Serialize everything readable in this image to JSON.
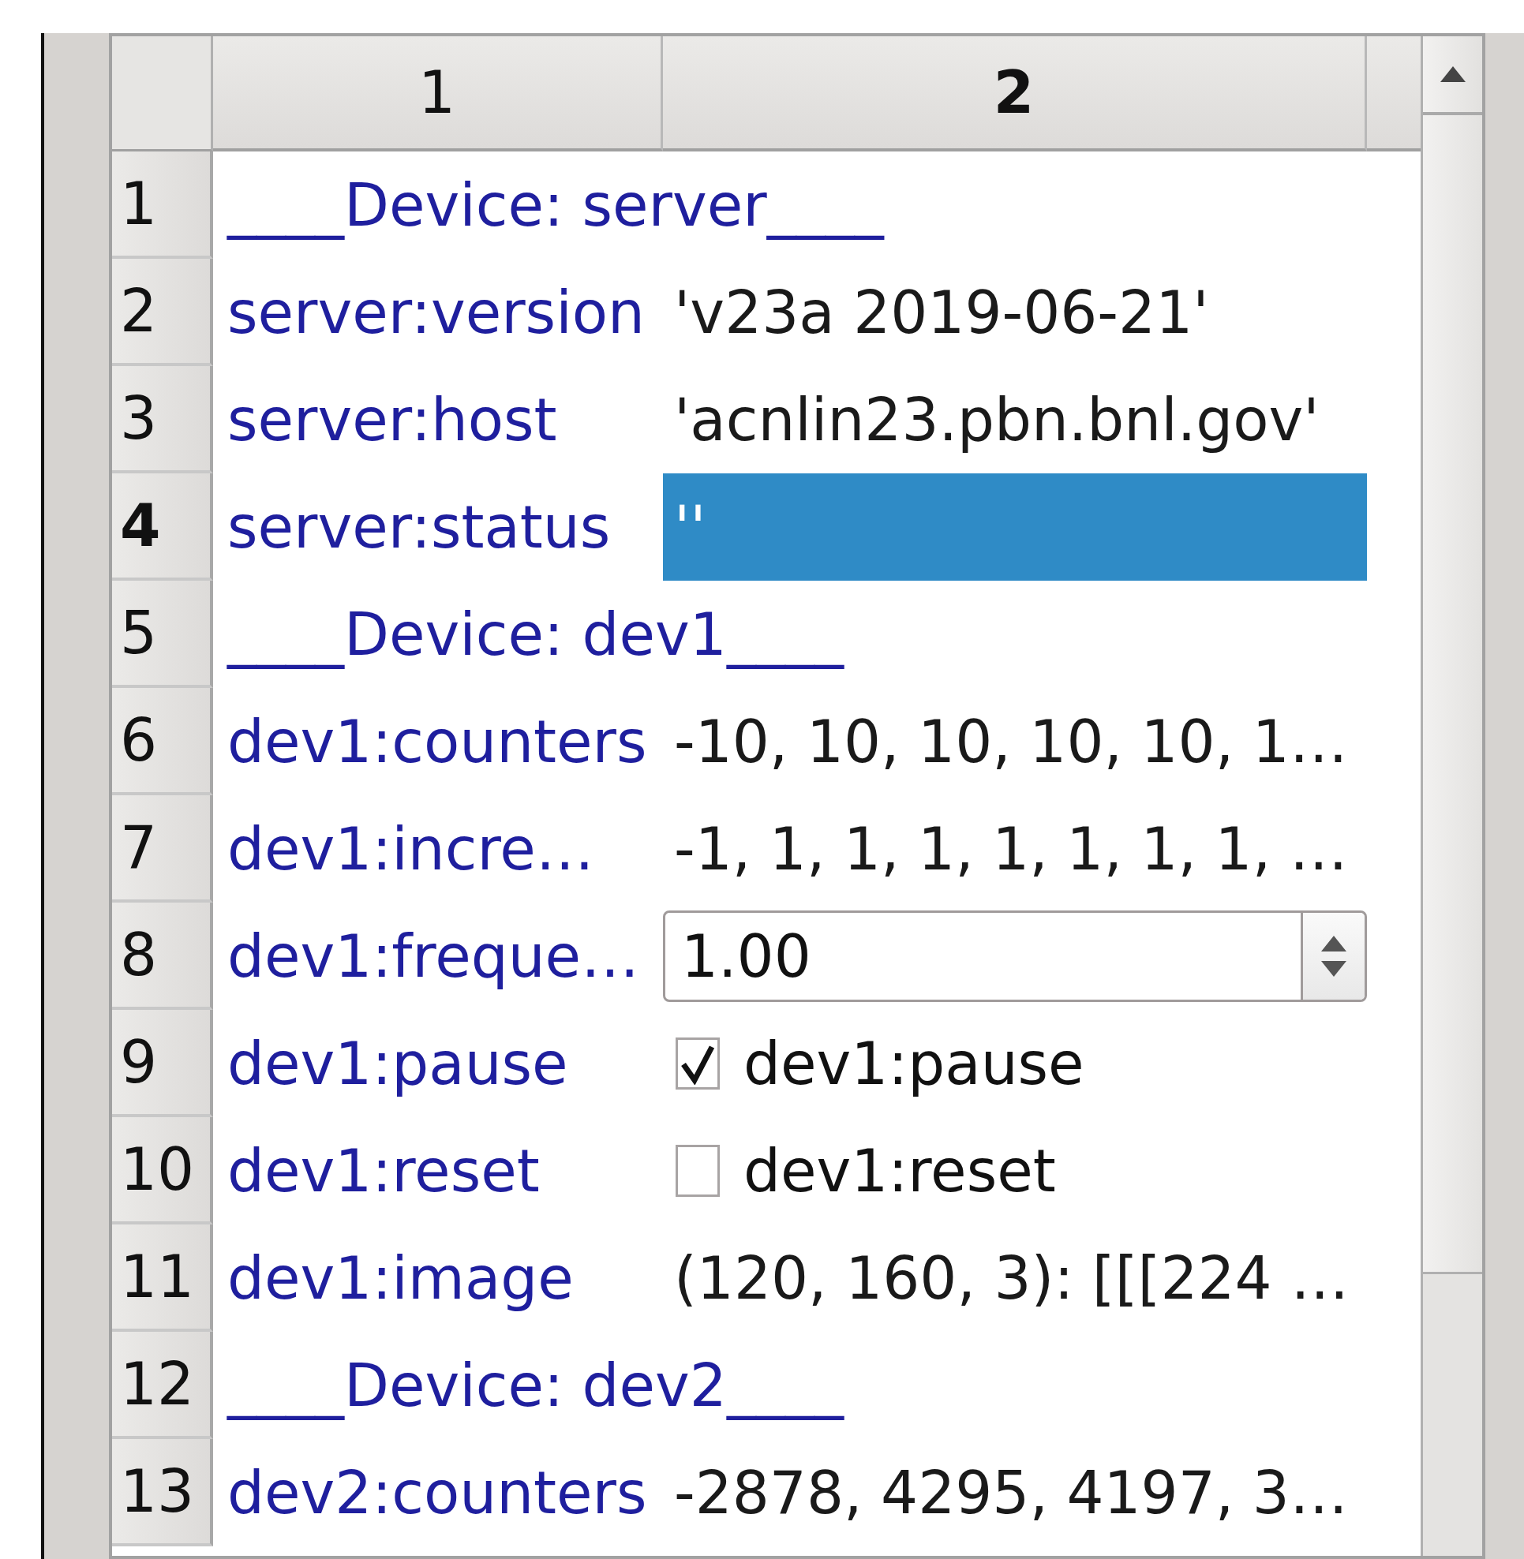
{
  "table": {
    "columns": [
      {
        "label": "1",
        "selected": false
      },
      {
        "label": "2",
        "selected": true
      }
    ],
    "rows": [
      {
        "number": "1",
        "selected": false,
        "kind": "section",
        "label": "____Device: server____"
      },
      {
        "number": "2",
        "selected": false,
        "kind": "text",
        "name": "server:version",
        "value": "'v23a 2019-06-21'"
      },
      {
        "number": "3",
        "selected": false,
        "kind": "text",
        "name": "server:host",
        "value": "'acnlin23.pbn.bnl.gov'"
      },
      {
        "number": "4",
        "selected": true,
        "kind": "text",
        "name": "server:status",
        "value": "''"
      },
      {
        "number": "5",
        "selected": false,
        "kind": "section",
        "label": "____Device: dev1____"
      },
      {
        "number": "6",
        "selected": false,
        "kind": "text",
        "name": "dev1:counters",
        "value": "-10, 10, 10, 10, 10, 1…"
      },
      {
        "number": "7",
        "selected": false,
        "kind": "text",
        "name": "dev1:incre…",
        "value": "-1, 1, 1, 1, 1, 1, 1, 1, …"
      },
      {
        "number": "8",
        "selected": false,
        "kind": "spinbox",
        "name": "dev1:freque…",
        "value": "1.00"
      },
      {
        "number": "9",
        "selected": false,
        "kind": "checkbox",
        "name": "dev1:pause",
        "checked": true,
        "label": "dev1:pause"
      },
      {
        "number": "10",
        "selected": false,
        "kind": "checkbox",
        "name": "dev1:reset",
        "checked": false,
        "label": "dev1:reset"
      },
      {
        "number": "11",
        "selected": false,
        "kind": "text",
        "name": "dev1:image",
        "value": "(120, 160, 3): [[[224 …"
      },
      {
        "number": "12",
        "selected": false,
        "kind": "section",
        "label": "____Device: dev2____"
      },
      {
        "number": "13",
        "selected": false,
        "kind": "text",
        "name": "dev2:counters",
        "value": "-2878, 4295, 4197, 3…"
      }
    ]
  }
}
